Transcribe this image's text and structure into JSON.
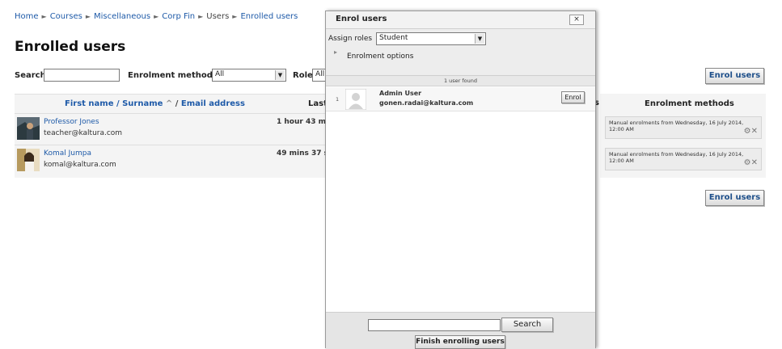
{
  "breadcrumb": [
    "Home",
    "Courses",
    "Miscellaneous",
    "Corp Fin",
    "Users",
    "Enrolled users"
  ],
  "breadcrumb_separator": "►",
  "page_title": "Enrolled users",
  "filters": {
    "search_label": "Search",
    "search_value": "",
    "enrolment_methods_label": "Enrolment methods",
    "enrolment_methods_value": "All",
    "role_label": "Role",
    "role_value": "All"
  },
  "enrol_users_button": "Enrol users",
  "table": {
    "name_header": "First name / Surname",
    "sort_indicator": "^",
    "header_separator": "/",
    "email_header": "Email address",
    "last_access_header": "Last",
    "enrolment_methods_header": "Enrolment methods",
    "rows": [
      {
        "name": "Professor Jones",
        "email": "teacher@kaltura.com",
        "last_access": "1 hour 43 mi",
        "enrolment": "Manual enrolments from Wednesday, 16 July 2014, 12:00 AM"
      },
      {
        "name": "Komal Jumpa",
        "email": "komal@kaltura.com",
        "last_access": "49 mins 37 s",
        "enrolment": "Manual enrolments from Wednesday, 16 July 2014, 12:00 AM"
      }
    ]
  },
  "dialog": {
    "title": "Enrol users",
    "close_label": "×",
    "assign_roles_label": "Assign roles",
    "assign_roles_value": "Student",
    "enrolment_options_label": "Enrolment options",
    "users_found": "1 user found",
    "results": [
      {
        "index": "1",
        "name": "Admin User",
        "email": "gonen.radai@kaltura.com",
        "enrol_label": "Enrol"
      }
    ],
    "search_value": "",
    "search_button": "Search",
    "finish_button": "Finish enrolling users"
  },
  "icons": {
    "expand": "triangle-right-icon",
    "card_actions": [
      "gear-icon",
      "delete-icon"
    ],
    "select_arrow": "chevron-down-icon"
  },
  "colors": {
    "link": "#1e5aa8",
    "panel_bg": "#f4f4f4"
  }
}
